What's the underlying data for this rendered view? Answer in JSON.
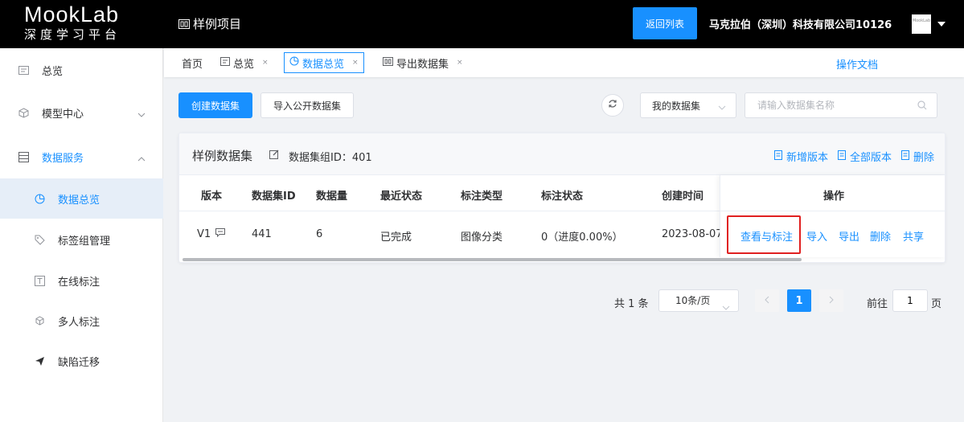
{
  "header": {
    "logo_main": "MookLab",
    "logo_sub": "深度学习平台",
    "project_title": "样例项目",
    "back_button": "返回列表",
    "company": "马克拉伯（深圳）科技有限公司10126",
    "avatar_text": "MookLab"
  },
  "sidebar": {
    "items": [
      {
        "label": "总览",
        "icon": "overview-icon"
      },
      {
        "label": "模型中心",
        "icon": "cube-icon"
      },
      {
        "label": "数据服务",
        "icon": "database-icon"
      },
      {
        "label": "数据总览",
        "icon": "pie-chart-icon"
      },
      {
        "label": "标签组管理",
        "icon": "tag-icon"
      },
      {
        "label": "在线标注",
        "icon": "text-box-icon"
      },
      {
        "label": "多人标注",
        "icon": "multi-cube-icon"
      },
      {
        "label": "缺陷迁移",
        "icon": "send-icon"
      }
    ]
  },
  "tabs": {
    "home": "首页",
    "items": [
      {
        "label": "总览"
      },
      {
        "label": "数据总览"
      },
      {
        "label": "导出数据集"
      }
    ],
    "close_glyph": "×",
    "doc_link": "操作文档"
  },
  "toolbar": {
    "create_label": "创建数据集",
    "import_label": "导入公开数据集",
    "select_value": "我的数据集",
    "search_placeholder": "请输入数据集名称"
  },
  "card": {
    "title": "样例数据集",
    "group_id": "数据集组ID：401",
    "actions": [
      "新增版本",
      "全部版本",
      "删除"
    ]
  },
  "table": {
    "columns": [
      "版本",
      "数据集ID",
      "数据量",
      "最近状态",
      "标注类型",
      "标注状态",
      "创建时间",
      "操作"
    ],
    "rows": [
      {
        "version": "V1",
        "dataset_id": "441",
        "count": "6",
        "status": "已完成",
        "label_type": "图像分类",
        "label_status": "0（进度0.00%）",
        "created": "2023-08-07",
        "ops": [
          "查看与标注",
          "导入",
          "导出",
          "删除",
          "共享"
        ]
      }
    ]
  },
  "pagination": {
    "total": "共 1 条",
    "page_size": "10条/页",
    "current_page": "1",
    "goto_label": "前往",
    "goto_value": "1",
    "goto_suffix": "页"
  },
  "colors": {
    "accent": "#1890ff",
    "highlight": "#e02020",
    "topbar": "#000000"
  }
}
